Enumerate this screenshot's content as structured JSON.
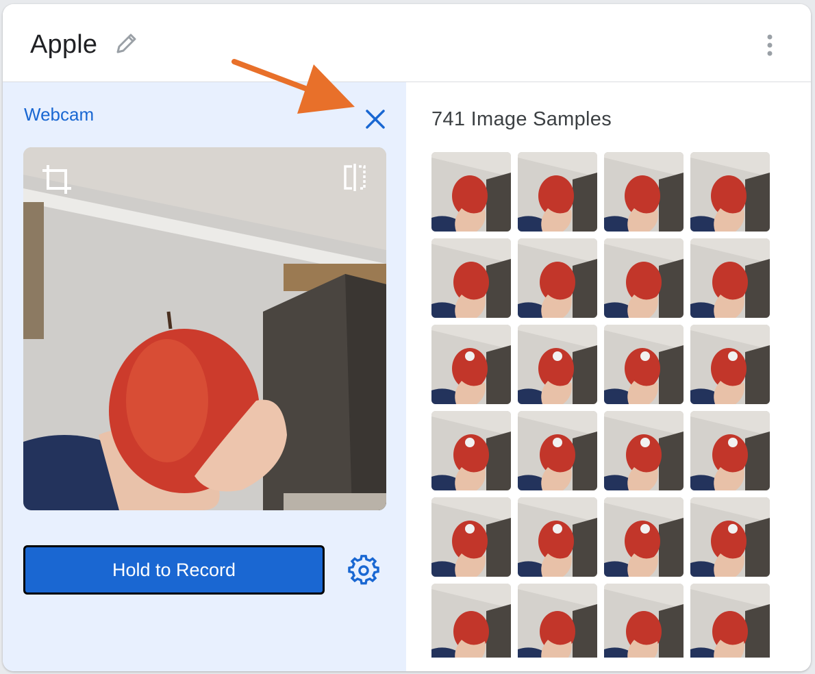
{
  "header": {
    "title": "Apple"
  },
  "webcam": {
    "label": "Webcam"
  },
  "record": {
    "label": "Hold to Record"
  },
  "samples": {
    "title": "741 Image Samples",
    "visible_thumbnails": 24,
    "columns": 4
  },
  "icons": {
    "edit": "pencil-icon",
    "more": "more-vert-icon",
    "close": "close-icon",
    "crop": "crop-icon",
    "flip": "flip-icon",
    "settings": "gear-icon",
    "annotation": "arrow-annotation"
  },
  "colors": {
    "accent": "#1967d2",
    "button": "#1a67d2",
    "panel": "#e8f0fe",
    "annotation_arrow": "#e8702a"
  }
}
